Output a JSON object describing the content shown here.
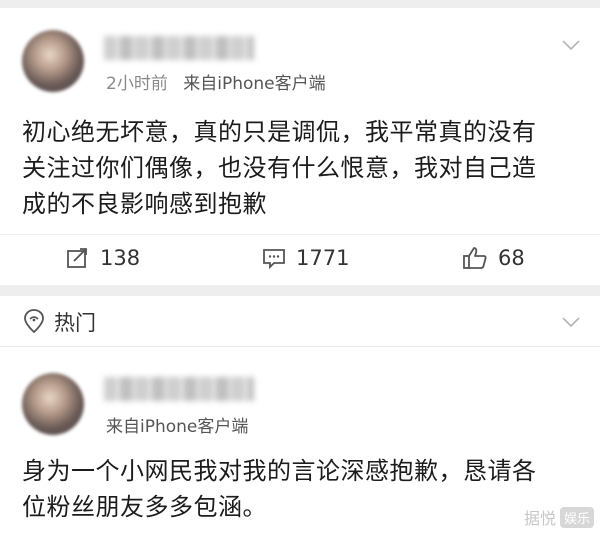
{
  "post1": {
    "time": "2小时前",
    "source": "来自iPhone客户端",
    "body_lines": [
      "初心绝无坏意，真的只是调侃，我平常真的没有",
      "关注过你们偶像，也没有什么恨意，我对自己造",
      "成的不良影响感到抱歉"
    ],
    "actions": {
      "repost_count": "138",
      "comment_count": "1771",
      "like_count": "68"
    }
  },
  "hot_section": {
    "label": "热门"
  },
  "post2": {
    "source": "来自iPhone客户端",
    "body_lines": [
      "身为一个小网民我对我的言论深感抱歉，恳请各",
      "位粉丝朋友多多包涵。"
    ]
  },
  "watermark": {
    "text": "据悦",
    "badge": "娱乐"
  },
  "icons": {
    "repost": "repost-icon",
    "comment": "comment-icon",
    "like": "thumbs-up-icon",
    "menu": "chevron-down-icon",
    "hot": "location-pin-icon"
  },
  "colors": {
    "background": "#eeeeee",
    "card": "#ffffff",
    "meta_gray": "#8a8a8a",
    "text": "#1c1c1c"
  }
}
